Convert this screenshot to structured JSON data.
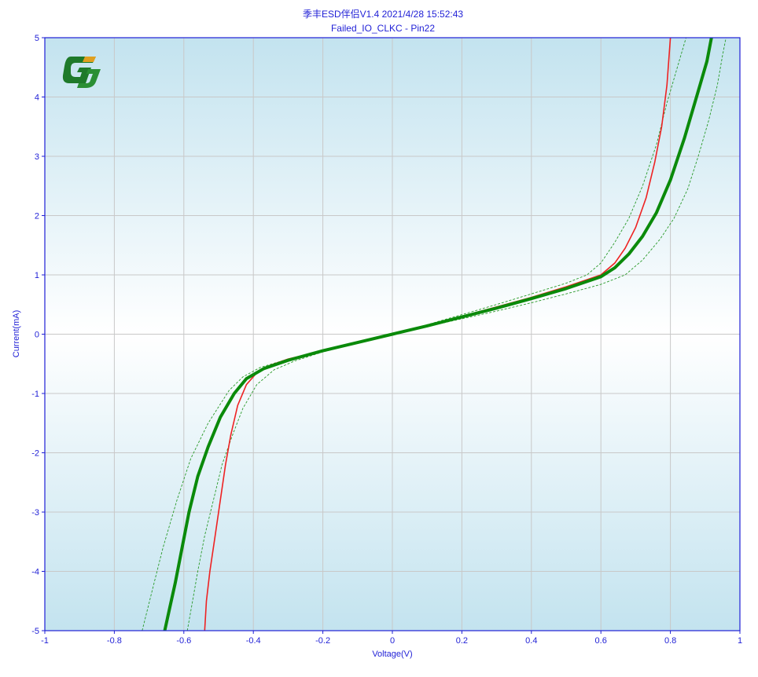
{
  "chart_data": {
    "type": "line",
    "title": "季丰ESD伴侣V1.4     2021/4/28 15:52:43",
    "subtitle": "Failed_IO_CLKC - Pin22",
    "xlabel": "Voltage(V)",
    "ylabel": "Current(mA)",
    "xlim": [
      -1,
      1
    ],
    "ylim": [
      -5,
      5
    ],
    "xticks": [
      "-1",
      "-0.8",
      "-0.6",
      "-0.4",
      "-0.2",
      "0",
      "0.2",
      "0.4",
      "0.6",
      "0.8",
      "1"
    ],
    "yticks": [
      "-5",
      "-4",
      "-3",
      "-2",
      "-1",
      "0",
      "1",
      "2",
      "3",
      "4",
      "5"
    ],
    "grid": true,
    "colors": {
      "axis": "#1f1fd6",
      "grid": "#c8c8c8",
      "red": "#ee2222",
      "green": "#0a8a0a",
      "dashed": "#2a9a2a",
      "bg_top": "#c3e3ef",
      "bg_mid": "#ffffff"
    },
    "series": [
      {
        "style": "red-solid",
        "points": [
          [
            -0.54,
            -5
          ],
          [
            -0.535,
            -4.5
          ],
          [
            -0.525,
            -4
          ],
          [
            -0.51,
            -3.4
          ],
          [
            -0.495,
            -2.8
          ],
          [
            -0.48,
            -2.2
          ],
          [
            -0.465,
            -1.7
          ],
          [
            -0.445,
            -1.2
          ],
          [
            -0.42,
            -0.85
          ],
          [
            -0.39,
            -0.65
          ],
          [
            -0.35,
            -0.52
          ],
          [
            -0.3,
            -0.42
          ],
          [
            -0.2,
            -0.28
          ],
          [
            -0.1,
            -0.14
          ],
          [
            0,
            0
          ],
          [
            0.1,
            0.15
          ],
          [
            0.2,
            0.3
          ],
          [
            0.3,
            0.46
          ],
          [
            0.4,
            0.62
          ],
          [
            0.5,
            0.8
          ],
          [
            0.6,
            1.0
          ],
          [
            0.64,
            1.2
          ],
          [
            0.67,
            1.45
          ],
          [
            0.7,
            1.8
          ],
          [
            0.73,
            2.3
          ],
          [
            0.755,
            2.9
          ],
          [
            0.775,
            3.5
          ],
          [
            0.79,
            4.2
          ],
          [
            0.8,
            5
          ]
        ]
      },
      {
        "style": "green-thick",
        "points": [
          [
            -0.655,
            -5
          ],
          [
            -0.64,
            -4.6
          ],
          [
            -0.625,
            -4.2
          ],
          [
            -0.605,
            -3.6
          ],
          [
            -0.585,
            -3.0
          ],
          [
            -0.56,
            -2.4
          ],
          [
            -0.53,
            -1.9
          ],
          [
            -0.495,
            -1.4
          ],
          [
            -0.455,
            -1.0
          ],
          [
            -0.42,
            -0.75
          ],
          [
            -0.37,
            -0.58
          ],
          [
            -0.3,
            -0.44
          ],
          [
            -0.2,
            -0.28
          ],
          [
            -0.1,
            -0.14
          ],
          [
            0,
            0
          ],
          [
            0.1,
            0.14
          ],
          [
            0.2,
            0.29
          ],
          [
            0.3,
            0.44
          ],
          [
            0.4,
            0.6
          ],
          [
            0.5,
            0.77
          ],
          [
            0.6,
            0.97
          ],
          [
            0.64,
            1.12
          ],
          [
            0.68,
            1.35
          ],
          [
            0.72,
            1.65
          ],
          [
            0.76,
            2.05
          ],
          [
            0.8,
            2.6
          ],
          [
            0.84,
            3.3
          ],
          [
            0.88,
            4.1
          ],
          [
            0.905,
            4.6
          ],
          [
            0.918,
            5
          ]
        ]
      },
      {
        "style": "green-dashed",
        "points": [
          [
            -0.72,
            -5
          ],
          [
            -0.69,
            -4.3
          ],
          [
            -0.66,
            -3.6
          ],
          [
            -0.62,
            -2.8
          ],
          [
            -0.58,
            -2.1
          ],
          [
            -0.53,
            -1.5
          ],
          [
            -0.47,
            -0.95
          ],
          [
            -0.43,
            -0.72
          ],
          [
            -0.38,
            -0.56
          ],
          [
            -0.3,
            -0.42
          ],
          [
            -0.2,
            -0.27
          ],
          [
            -0.1,
            -0.13
          ],
          [
            0,
            0
          ],
          [
            0.1,
            0.16
          ],
          [
            0.2,
            0.33
          ],
          [
            0.3,
            0.5
          ],
          [
            0.4,
            0.68
          ],
          [
            0.5,
            0.86
          ],
          [
            0.56,
            1.0
          ],
          [
            0.6,
            1.2
          ],
          [
            0.64,
            1.55
          ],
          [
            0.68,
            1.95
          ],
          [
            0.72,
            2.5
          ],
          [
            0.76,
            3.2
          ],
          [
            0.79,
            3.9
          ],
          [
            0.82,
            4.5
          ],
          [
            0.845,
            5
          ]
        ]
      },
      {
        "style": "green-dashed",
        "points": [
          [
            -0.59,
            -5
          ],
          [
            -0.575,
            -4.5
          ],
          [
            -0.56,
            -4.0
          ],
          [
            -0.54,
            -3.4
          ],
          [
            -0.515,
            -2.8
          ],
          [
            -0.49,
            -2.2
          ],
          [
            -0.46,
            -1.7
          ],
          [
            -0.43,
            -1.25
          ],
          [
            -0.39,
            -0.85
          ],
          [
            -0.34,
            -0.6
          ],
          [
            -0.28,
            -0.45
          ],
          [
            -0.2,
            -0.3
          ],
          [
            -0.1,
            -0.15
          ],
          [
            0,
            0
          ],
          [
            0.1,
            0.13
          ],
          [
            0.2,
            0.26
          ],
          [
            0.3,
            0.39
          ],
          [
            0.4,
            0.53
          ],
          [
            0.5,
            0.68
          ],
          [
            0.6,
            0.84
          ],
          [
            0.67,
            1.0
          ],
          [
            0.72,
            1.25
          ],
          [
            0.77,
            1.6
          ],
          [
            0.81,
            1.95
          ],
          [
            0.85,
            2.45
          ],
          [
            0.88,
            3.0
          ],
          [
            0.91,
            3.6
          ],
          [
            0.935,
            4.2
          ],
          [
            0.95,
            4.7
          ],
          [
            0.96,
            5
          ]
        ]
      }
    ]
  }
}
